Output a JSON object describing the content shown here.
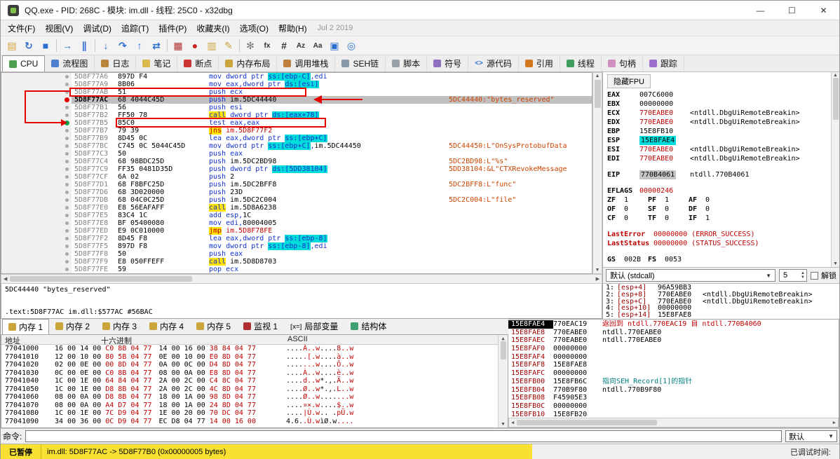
{
  "titlebar": {
    "title": "QQ.exe - PID: 268C - 模块: im.dll - 线程: 25C0 - x32dbg",
    "minimize": "—",
    "maximize": "☐",
    "close": "✕"
  },
  "menu": {
    "items": [
      "文件(F)",
      "视图(V)",
      "调试(D)",
      "追踪(T)",
      "插件(P)",
      "收藏夹(I)",
      "选项(O)",
      "帮助(H)"
    ],
    "date": "Jul 2 2019"
  },
  "toolbar": {
    "icons": [
      {
        "name": "open-file-icon",
        "glyph": "▤",
        "color": "#d8a23a"
      },
      {
        "name": "restart-icon",
        "glyph": "↻",
        "color": "#2a6fd0"
      },
      {
        "name": "stop-icon",
        "glyph": "■",
        "color": "#2a6fd0"
      },
      {
        "sep": true
      },
      {
        "name": "run-icon",
        "glyph": "→",
        "color": "#2a6fd0"
      },
      {
        "name": "pause-icon",
        "glyph": "∥",
        "color": "#2a6fd0"
      },
      {
        "sep": true
      },
      {
        "name": "step-into-icon",
        "glyph": "↓",
        "color": "#2a6fd0"
      },
      {
        "name": "step-over-icon",
        "glyph": "↷",
        "color": "#2a6fd0"
      },
      {
        "name": "step-out-icon",
        "glyph": "↑",
        "color": "#2a6fd0"
      },
      {
        "name": "run-trace-icon",
        "glyph": "⇄",
        "color": "#2a6fd0"
      },
      {
        "sep": true
      },
      {
        "name": "scylla-icon",
        "glyph": "▦",
        "color": "#b03030"
      },
      {
        "name": "breakpoints-icon",
        "glyph": "●",
        "color": "#cc2222"
      },
      {
        "name": "memory-map-icon",
        "glyph": "▥",
        "color": "#caa53c"
      },
      {
        "name": "notes-icon",
        "glyph": "✎",
        "color": "#caa53c"
      },
      {
        "sep": true
      },
      {
        "name": "settings-icon",
        "glyph": "✻",
        "color": "#777777"
      },
      {
        "name": "fx-icon",
        "glyph": "fx",
        "color": "#333333"
      },
      {
        "name": "hash-icon",
        "glyph": "#",
        "color": "#333333"
      },
      {
        "name": "az-icon",
        "glyph": "Az",
        "color": "#333333"
      },
      {
        "name": "aa-icon",
        "glyph": "Aa",
        "color": "#333333"
      },
      {
        "name": "window-icon",
        "glyph": "▣",
        "color": "#2a6fd0"
      },
      {
        "name": "spy-icon",
        "glyph": "◎",
        "color": "#2a6fd0"
      }
    ]
  },
  "view_tabs": [
    {
      "id": "cpu",
      "label": "CPU",
      "color": "#4f9f4f",
      "active": true
    },
    {
      "id": "graph",
      "label": "流程图",
      "color": "#4f7fd0"
    },
    {
      "id": "log",
      "label": "日志",
      "color": "#b8863b"
    },
    {
      "id": "notes",
      "label": "笔记",
      "color": "#d8b94a"
    },
    {
      "id": "breakpoints",
      "label": "断点",
      "color": "#cc3333"
    },
    {
      "id": "memory-map",
      "label": "内存布局",
      "color": "#caa53c"
    },
    {
      "id": "call-stack",
      "label": "调用堆栈",
      "color": "#bf7f3f"
    },
    {
      "id": "seh-chain",
      "label": "SEH链",
      "color": "#8899aa"
    },
    {
      "id": "script",
      "label": "脚本",
      "color": "#9aa0a8"
    },
    {
      "id": "symbols",
      "label": "符号",
      "color": "#8f6fbf"
    },
    {
      "id": "source",
      "label": "源代码",
      "glyph": "<>"
    },
    {
      "id": "references",
      "label": "引用",
      "color": "#d2791e"
    },
    {
      "id": "threads",
      "label": "线程",
      "color": "#3f9f5f"
    },
    {
      "id": "handles",
      "label": "句柄",
      "color": "#cf8fbf"
    },
    {
      "id": "trace",
      "label": "跟踪",
      "color": "#9f6fcf"
    }
  ],
  "disasm": {
    "rows": [
      {
        "a": "5D8F77A6",
        "b": "897D F4",
        "i": "mov dword ptr ss:[ebp-C],edi"
      },
      {
        "a": "5D8F77A9",
        "b": "8B06",
        "i": "mov eax,dword ptr ds:[esi]"
      },
      {
        "a": "5D8F77AB",
        "b": "51",
        "i": "push ecx"
      },
      {
        "a": "5D8F77AC",
        "b": "68 4044C45D",
        "i": "push im.5DC44440",
        "c": "5DC44440:\"bytes_reserved\"",
        "sel": true,
        "bp": "red"
      },
      {
        "a": "5D8F77B1",
        "b": "56",
        "i": "push esi"
      },
      {
        "a": "5D8F77B2",
        "b": "FF50 78",
        "i": "call dword ptr ds:[eax+78]"
      },
      {
        "a": "5D8F77B5",
        "b": "85C0",
        "i": "test eax,eax",
        "bp": "green"
      },
      {
        "a": "5D8F77B7",
        "b": "79 39",
        "i": "jns im.5D8F77F2"
      },
      {
        "a": "5D8F77B9",
        "b": "8D45 0C",
        "i": "lea eax,dword ptr ss:[ebp+C]"
      },
      {
        "a": "5D8F77BC",
        "b": "C745 0C 5044C45D",
        "i": "mov dword ptr ss:[ebp+C],im.5DC44450",
        "c": "5DC44450:L\"OnSysProtobufData"
      },
      {
        "a": "5D8F77C3",
        "b": "50",
        "i": "push eax"
      },
      {
        "a": "5D8F77C4",
        "b": "68 98BDC25D",
        "i": "push im.5DC2BD98",
        "c": "5DC2BD98:L\"%s\""
      },
      {
        "a": "5D8F77C9",
        "b": "FF35 0481D35D",
        "i": "push dword ptr ds:[5DD38104]",
        "c": "5DD38104:&L\"CTXRevokeMessage"
      },
      {
        "a": "5D8F77CF",
        "b": "6A 02",
        "i": "push 2"
      },
      {
        "a": "5D8F77D1",
        "b": "68 F8BFC25D",
        "i": "push im.5DC2BFF8",
        "c": "5DC2BFF8:L\"func\""
      },
      {
        "a": "5D8F77D6",
        "b": "68 3D020000",
        "i": "push 23D"
      },
      {
        "a": "5D8F77DB",
        "b": "68 04C0C25D",
        "i": "push im.5DC2C004",
        "c": "5DC2C004:L\"file\""
      },
      {
        "a": "5D8F77E0",
        "b": "E8 56EAFAFF",
        "i": "call im.5D8A6238"
      },
      {
        "a": "5D8F77E5",
        "b": "83C4 1C",
        "i": "add esp,1C"
      },
      {
        "a": "5D8F77E8",
        "b": "BF 05400080",
        "i": "mov edi,80004005"
      },
      {
        "a": "5D8F77ED",
        "b": "E9 0C010000",
        "i": "jmp im.5D8F78FE"
      },
      {
        "a": "5D8F77F2",
        "b": "8D45 F8",
        "i": "lea eax,dword ptr ss:[ebp-8]"
      },
      {
        "a": "5D8F77F5",
        "b": "897D F8",
        "i": "mov dword ptr ss:[ebp-8],edi"
      },
      {
        "a": "5D8F77F8",
        "b": "50",
        "i": "push eax"
      },
      {
        "a": "5D8F77F9",
        "b": "E8 050FFEFF",
        "i": "call im.5D8D8703"
      },
      {
        "a": "5D8F77FE",
        "b": "59",
        "i": "pop ecx"
      }
    ]
  },
  "info_box": {
    "line1": "5DC44440 \"bytes_reserved\"",
    "line2": ".text:5D8F77AC im.dll:$577AC #56BAC"
  },
  "registers": {
    "hide_fpu": "隐藏FPU",
    "lines": [
      {
        "t": "reg",
        "n": "EAX",
        "v": "007C6000"
      },
      {
        "t": "reg",
        "n": "EBX",
        "v": "00000000"
      },
      {
        "t": "reg",
        "n": "ECX",
        "v": "770EABE0",
        "c": "<ntdll.DbgUiRemoteBreakin>",
        "vc": "red"
      },
      {
        "t": "reg",
        "n": "EDX",
        "v": "770EABE0",
        "c": "<ntdll.DbgUiRemoteBreakin>",
        "vc": "red"
      },
      {
        "t": "reg",
        "n": "EBP",
        "v": "15E8FB10"
      },
      {
        "t": "reg",
        "n": "ESP",
        "v": "15E8FAE4",
        "vc": "esp"
      },
      {
        "t": "reg",
        "n": "ESI",
        "v": "770EABE0",
        "c": "<ntdll.DbgUiRemoteBreakin>",
        "vc": "red"
      },
      {
        "t": "reg",
        "n": "EDI",
        "v": "770EABE0",
        "c": "<ntdll.DbgUiRemoteBreakin>",
        "vc": "red"
      },
      {
        "t": "gap"
      },
      {
        "t": "reg",
        "n": "EIP",
        "v": "770B4061",
        "c": "ntdll.770B4061",
        "vc": "eip"
      },
      {
        "t": "gap"
      },
      {
        "t": "reg",
        "n": "EFLAGS",
        "v": "00000246",
        "vc": "red"
      },
      {
        "t": "flags",
        "items": [
          [
            "ZF",
            "1"
          ],
          [
            "PF",
            "1"
          ],
          [
            "AF",
            "0"
          ]
        ]
      },
      {
        "t": "flags",
        "items": [
          [
            "OF",
            "0"
          ],
          [
            "SF",
            "0"
          ],
          [
            "DF",
            "0"
          ]
        ]
      },
      {
        "t": "flags",
        "items": [
          [
            "CF",
            "0"
          ],
          [
            "TF",
            "0"
          ],
          [
            "IF",
            "1"
          ]
        ]
      },
      {
        "t": "gap"
      },
      {
        "t": "last",
        "n": "LastError",
        "v": "00000000 (ERROR_SUCCESS)"
      },
      {
        "t": "last",
        "n": "LastStatus",
        "v": "00000000 (STATUS_SUCCESS)"
      },
      {
        "t": "gap"
      },
      {
        "t": "flags",
        "items": [
          [
            "GS",
            "002B"
          ],
          [
            "FS",
            "0053"
          ]
        ]
      }
    ]
  },
  "convention": {
    "mode": "默认 (stdcall)",
    "depth": "5",
    "unlock": "解锁"
  },
  "args": {
    "rows": [
      {
        "i": "1:",
        "e": "[esp+4]",
        "v": "96A59BB3"
      },
      {
        "i": "2:",
        "e": "[esp+8]",
        "v": "770EABE0",
        "c": "<ntdll.DbgUiRemoteBreakin>"
      },
      {
        "i": "3:",
        "e": "[esp+C]",
        "v": "770EABE0",
        "c": "<ntdll.DbgUiRemoteBreakin>"
      },
      {
        "i": "4:",
        "e": "[esp+10]",
        "v": "00000000"
      },
      {
        "i": "5:",
        "e": "[esp+14]",
        "v": "15E8FAE8"
      }
    ]
  },
  "dump_tabs": [
    {
      "id": "mem1",
      "label": "内存 1",
      "color": "#caa53c",
      "active": true
    },
    {
      "id": "mem2",
      "label": "内存 2",
      "color": "#caa53c"
    },
    {
      "id": "mem3",
      "label": "内存 3",
      "color": "#caa53c"
    },
    {
      "id": "mem4",
      "label": "内存 4",
      "color": "#caa53c"
    },
    {
      "id": "mem5",
      "label": "内存 5",
      "color": "#caa53c"
    },
    {
      "id": "watch1",
      "label": "监视 1",
      "color": "#b03030"
    },
    {
      "id": "locals",
      "label": "局部变量",
      "glyph": "[x=]"
    },
    {
      "id": "struct",
      "label": "结构体",
      "color": "#3f9f6f"
    }
  ],
  "dump": {
    "headers": [
      "地址",
      "十六进制",
      "ASCII"
    ],
    "rows": [
      {
        "addr": "77041000",
        "bytes": "16 00 14 00 C0 8B 04 77 14 00 16 00 38 84 04 77"
      },
      {
        "addr": "77041010",
        "bytes": "12 00 10 00 80 5B 04 77 0E 00 10 00 E0 8D 04 77"
      },
      {
        "addr": "77041020",
        "bytes": "02 00 0E 00 00 8D 04 77 0A 00 0C 00 D4 8D 04 77"
      },
      {
        "addr": "77041030",
        "bytes": "0C 00 0E 00 C0 8B 04 77 08 00 0A 00 E8 8D 04 77"
      },
      {
        "addr": "77041040",
        "bytes": "1C 00 1E 00 64 84 04 77 2A 00 2C 00 C4 8C 04 77"
      },
      {
        "addr": "77041050",
        "bytes": "1C 00 1E 00 D8 8B 04 77 2A 00 2C 00 4C 8D 04 77"
      },
      {
        "addr": "77041060",
        "bytes": "08 00 0A 00 D8 8B 04 77 18 00 1A 00 98 8D 04 77"
      },
      {
        "addr": "77041070",
        "bytes": "08 00 0A 00 A4 D7 04 77 18 00 1A 00 24 8D 04 77"
      },
      {
        "addr": "77041080",
        "bytes": "1C 00 1E 00 7C D9 04 77 1E 00 20 00 70 DC 04 77"
      },
      {
        "addr": "77041090",
        "bytes": "34 00 36 00 0C D9 04 77 EC D8 04 77 14 00 16 00"
      }
    ]
  },
  "stack": {
    "rows": [
      {
        "addr": "15E8FAE4",
        "value": "770EAC19",
        "comment": "返回到 ntdll.770EAC19 自 ntdll.770B4060",
        "ctype": "ret",
        "sel": true
      },
      {
        "addr": "15E8FAE8",
        "value": "770EABE0",
        "comment": "ntdll.770EABE0"
      },
      {
        "addr": "15E8FAEC",
        "value": "770EABE0",
        "comment": "ntdll.770EABE0"
      },
      {
        "addr": "15E8FAF0",
        "value": "00000000"
      },
      {
        "addr": "15E8FAF4",
        "value": "00000000"
      },
      {
        "addr": "15E8FAF8",
        "value": "15E8FAE8"
      },
      {
        "addr": "15E8FAFC",
        "value": "00000000"
      },
      {
        "addr": "15E8FB00",
        "value": "15E8FB6C",
        "comment": "指向SEH_Record[1]的指针",
        "ctype": "seh"
      },
      {
        "addr": "15E8FB04",
        "value": "770B9F80",
        "comment": "ntdll.770B9F80"
      },
      {
        "addr": "15E8FB08",
        "value": "F45905E3"
      },
      {
        "addr": "15E8FB0C",
        "value": "00000000"
      },
      {
        "addr": "15E8FB10",
        "value": "15E8FB20"
      }
    ]
  },
  "command": {
    "label": "命令:",
    "value": "",
    "combo": "默认"
  },
  "status": {
    "state": "已暂停",
    "message": "im.dll: 5D8F77AC -> 5D8F77B0 (0x00000005 bytes)",
    "right": "已调试时间:"
  }
}
